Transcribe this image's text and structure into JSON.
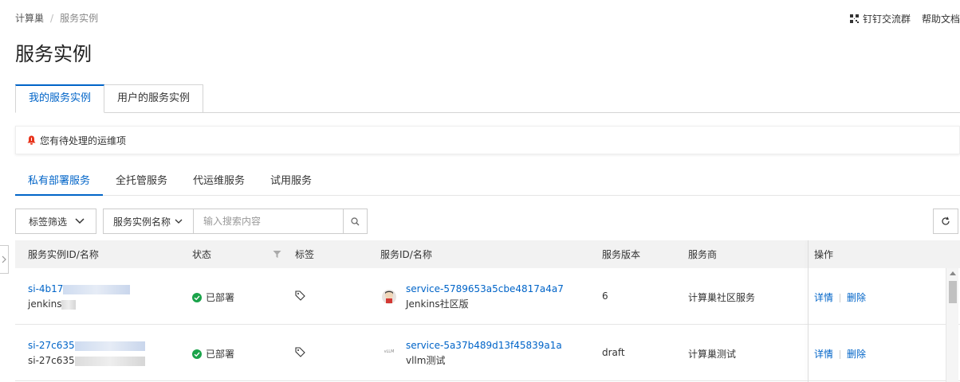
{
  "breadcrumb": {
    "root": "计算巢",
    "current": "服务实例"
  },
  "top_links": {
    "dingtalk": "钉钉交流群",
    "help": "帮助文档"
  },
  "page_title": "服务实例",
  "main_tabs": [
    {
      "label": "我的服务实例"
    },
    {
      "label": "用户的服务实例"
    }
  ],
  "notice": {
    "text": "您有待处理的运维项"
  },
  "sub_tabs": [
    {
      "label": "私有部署服务"
    },
    {
      "label": "全托管服务"
    },
    {
      "label": "代运维服务"
    },
    {
      "label": "试用服务"
    }
  ],
  "filters": {
    "tag_filter": "标签筛选",
    "search_type": "服务实例名称",
    "search_placeholder": "输入搜索内容"
  },
  "table": {
    "columns": [
      "服务实例ID/名称",
      "状态",
      "标签",
      "服务ID/名称",
      "服务版本",
      "服务商",
      "操作"
    ],
    "rows": [
      {
        "instance_id": "si-4b17",
        "instance_name": "jenkins",
        "status": "已部署",
        "service_id": "service-5789653a5cbe4817a4a7",
        "service_name": "Jenkins社区版",
        "version": "6",
        "provider": "计算巢社区服务",
        "actions": [
          "详情",
          "删除"
        ]
      },
      {
        "instance_id": "si-27c635",
        "instance_name": "si-27c635",
        "status": "已部署",
        "service_id": "service-5a37b489d13f45839a1a",
        "service_name": "vllm测试",
        "logo_text": "vLLM",
        "version": "draft",
        "provider": "计算巢测试",
        "actions": [
          "详情",
          "删除"
        ]
      }
    ]
  },
  "colors": {
    "accent": "#0064c8",
    "success": "#1aa34a",
    "alert": "#e8341c"
  }
}
